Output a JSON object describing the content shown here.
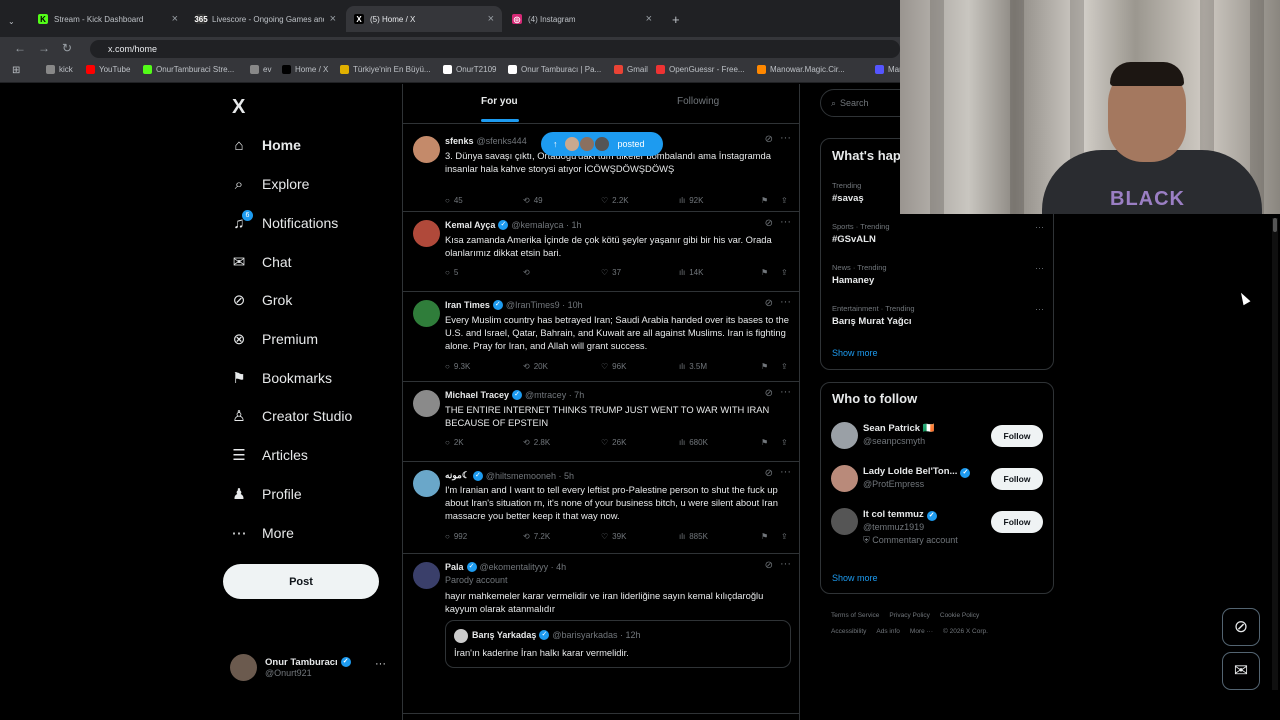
{
  "browser": {
    "tabs": [
      {
        "label": "Stream - Kick Dashboard",
        "fav": "K",
        "color": "#53fc18"
      },
      {
        "label": "Livescore - Ongoing Games and",
        "fav": "365",
        "color": "#333"
      },
      {
        "label": "(5) Home / X",
        "fav": "X",
        "color": "#000"
      },
      {
        "label": "(4) Instagram",
        "fav": "◎",
        "color": "#d62976"
      }
    ],
    "new_tab": "+",
    "url": "x.com/home",
    "bookmarks": [
      {
        "label": "kick",
        "color": "#888"
      },
      {
        "label": "YouTube",
        "color": "#ff0000"
      },
      {
        "label": "OnurTamburaci Stre...",
        "color": "#53fc18"
      },
      {
        "label": "ev",
        "color": "#888"
      },
      {
        "label": "Home / X",
        "color": "#000"
      },
      {
        "label": "Türkiye'nin En Büyü...",
        "color": "#e0b000"
      },
      {
        "label": "OnurT2109",
        "color": "#fff"
      },
      {
        "label": "Onur Tamburacı | Pa...",
        "color": "#fff"
      },
      {
        "label": "Gmail",
        "color": "#ea4335"
      },
      {
        "label": "OpenGuessr - Free...",
        "color": "#e33"
      },
      {
        "label": "Manowar.Magic.Cir...",
        "color": "#f80"
      },
      {
        "label": "Marado",
        "color": "#55f"
      }
    ]
  },
  "nav": {
    "logo": "X",
    "items": [
      {
        "label": "Home",
        "icon": "⌂"
      },
      {
        "label": "Explore",
        "icon": "⌕"
      },
      {
        "label": "Notifications",
        "icon": "♫"
      },
      {
        "label": "Chat",
        "icon": "✉"
      },
      {
        "label": "Grok",
        "icon": "⊘"
      },
      {
        "label": "Premium",
        "icon": "⊗"
      },
      {
        "label": "Bookmarks",
        "icon": "⚑"
      },
      {
        "label": "Creator Studio",
        "icon": "♙"
      },
      {
        "label": "Articles",
        "icon": "☰"
      },
      {
        "label": "Profile",
        "icon": "♟"
      },
      {
        "label": "More",
        "icon": "⋯"
      }
    ],
    "notif_badge": "6",
    "post_label": "Post",
    "account": {
      "name": "Onur Tamburacı",
      "handle": "@Onurt921",
      "more": "···"
    }
  },
  "feed": {
    "tabs": [
      "For you",
      "Following"
    ],
    "posted_pill": {
      "arrow": "↑",
      "label": "posted"
    },
    "tweets": [
      {
        "name": "sfenks",
        "handle": "@sfenks444",
        "time": "",
        "verified": false,
        "text": "3. Dünya savaşı çıktı, Ortadoğu'daki tüm ülkeler bombalandı ama İnstagramda insanlar hala kahve storysi atıyor İCÖWŞDÖWŞDÖWŞ",
        "replies": "45",
        "reposts": "49",
        "likes": "2.2K",
        "views": "92K",
        "avcolor": "#c48a6a"
      },
      {
        "name": "Kemal Ayça",
        "handle": "@kemalayca · 1h",
        "verified": true,
        "text": "Kısa zamanda Amerika İçinde de çok kötü şeyler yaşanır gibi bir his var. Orada olanlarımız dikkat etsin bari.",
        "replies": "5",
        "reposts": "",
        "likes": "37",
        "views": "14K",
        "avcolor": "#b0493a"
      },
      {
        "name": "Iran Times",
        "handle": "@IranTimes9 · 10h",
        "verified": true,
        "text": "Every Muslim country has betrayed Iran; Saudi Arabia handed over its bases to the U.S. and Israel, Qatar, Bahrain, and Kuwait are all against Muslims. Iran is fighting alone. Pray for Iran, and Allah will grant success.",
        "replies": "9.3K",
        "reposts": "20K",
        "likes": "96K",
        "views": "3.5M",
        "avcolor": "#2f7d3a"
      },
      {
        "name": "Michael Tracey",
        "handle": "@mtracey · 7h",
        "verified": true,
        "text": "THE ENTIRE INTERNET THINKS TRUMP JUST WENT TO WAR WITH IRAN BECAUSE OF EPSTEIN",
        "replies": "2K",
        "reposts": "2.8K",
        "likes": "26K",
        "views": "680K",
        "avcolor": "#8a8a8a"
      },
      {
        "name": "ﻣﻮﻧﻪ☾",
        "handle": "@hiltsmemooneh · 5h",
        "verified": true,
        "text": "I'm Iranian and I want to tell every leftist pro-Palestine person to shut the fuck up about Iran's situation rn, it's none of your business bitch, u were silent about Iran massacre you better keep it that way now.",
        "replies": "992",
        "reposts": "7.2K",
        "likes": "39K",
        "views": "885K",
        "avcolor": "#6aa7c9"
      },
      {
        "name": "Pala",
        "handle": "@ekomentalityyy · 4h",
        "verified": true,
        "label": "Parody account",
        "text": "hayır mahkemeler karar vermelidir ve iran liderliğine sayın kemal kılıçdaroğlu kayyum olarak atanmalıdır",
        "quote": {
          "name": "Barış Yarkadaş",
          "handle": "@barisyarkadas · 12h",
          "text": "İran'ın kaderine İran halkı karar vermelidir."
        },
        "avcolor": "#3a3f6a"
      }
    ]
  },
  "right": {
    "search_placeholder": "Search",
    "happening_title": "What's hap",
    "trends": [
      {
        "cat": "Trending",
        "title": "#savaş"
      },
      {
        "cat": "Sports · Trending",
        "title": "#GSvALN"
      },
      {
        "cat": "News · Trending",
        "title": "Hamaney"
      },
      {
        "cat": "Entertainment · Trending",
        "title": "Barış Murat Yağcı"
      }
    ],
    "show_more": "Show more",
    "who_title": "Who to follow",
    "follow": [
      {
        "name": "Sean Patrick 🇮🇪",
        "handle": "@seanpcsmyth",
        "extra": "",
        "verified": false,
        "avcolor": "#9aa0a6"
      },
      {
        "name": "Lady Lolde Bel'Ton...",
        "handle": "@ProtEmpress",
        "extra": "",
        "verified": true,
        "avcolor": "#b98a7a"
      },
      {
        "name": "It col temmuz",
        "handle": "@temmuz1919",
        "extra": "Commentary account",
        "verified": true,
        "avcolor": "#555"
      }
    ],
    "follow_label": "Follow",
    "footer": [
      "Terms of Service",
      "Privacy Policy",
      "Cookie Policy",
      "Accessibility",
      "Ads info",
      "More ···",
      "© 2026 X Corp."
    ]
  },
  "webcam": {
    "shirt": "BLACK"
  },
  "fabs": [
    "⊘",
    "✉"
  ]
}
